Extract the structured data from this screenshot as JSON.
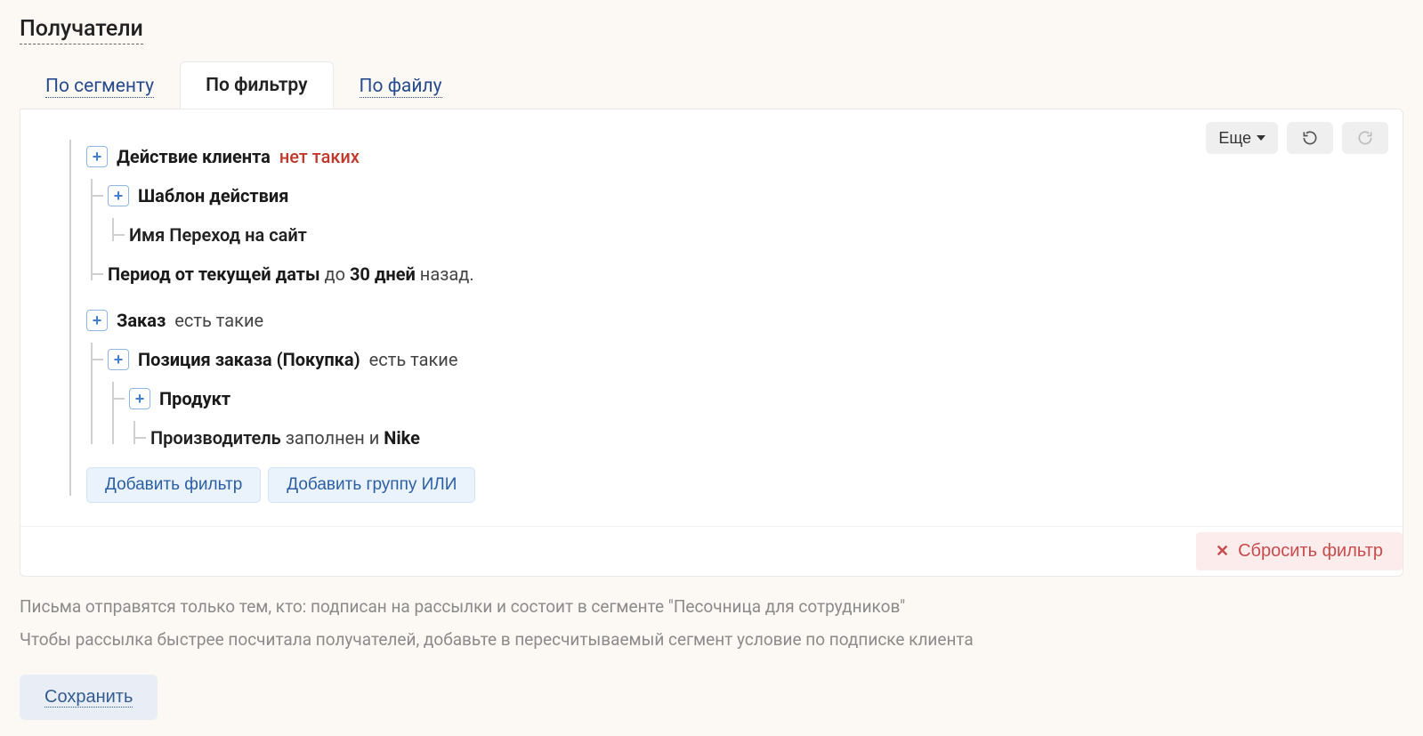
{
  "title": "Получатели",
  "tabs": {
    "segment": "По сегменту",
    "filter": "По фильтру",
    "file": "По файлу",
    "active": "filter"
  },
  "toolbar": {
    "more_label": "Еще"
  },
  "tree": {
    "client_action": {
      "title": "Действие клиента",
      "qualifier": "нет таких",
      "template": {
        "title": "Шаблон действия",
        "name_label": "Имя",
        "name_value": "Переход на сайт"
      },
      "period_prefix": "Период от текущей даты",
      "period_to": "до",
      "period_days": "30 дней",
      "period_suffix": "назад."
    },
    "order": {
      "title": "Заказ",
      "qualifier": "есть такие",
      "line_item": {
        "title": "Позиция заказа (Покупка)",
        "qualifier": "есть такие",
        "product": {
          "title": "Продукт",
          "manufacturer_label": "Производитель",
          "manufacturer_cond": "заполнен и",
          "manufacturer_value": "Nike"
        }
      }
    }
  },
  "actions": {
    "add_filter": "Добавить фильтр",
    "add_or_group": "Добавить группу ИЛИ",
    "reset_filter": "Сбросить фильтр"
  },
  "hints": {
    "line1": "Письма отправятся только тем, кто: подписан на рассылки и состоит в сегменте \"Песочница для сотрудников\"",
    "line2": "Чтобы рассылка быстрее посчитала получателей, добавьте в пересчитываемый сегмент условие по подписке клиента"
  },
  "save_label": "Сохранить"
}
